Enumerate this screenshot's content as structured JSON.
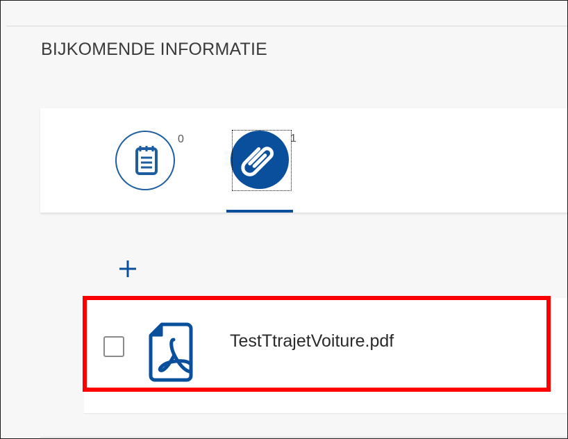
{
  "section": {
    "title": "BIJKOMENDE INFORMATIE"
  },
  "tabs": [
    {
      "icon": "notes-icon",
      "count": "0",
      "selected": false
    },
    {
      "icon": "paperclip-icon",
      "count": "1",
      "selected": true
    }
  ],
  "attachments": {
    "add_icon": "plus-icon",
    "items": [
      {
        "name": "TestTtrajetVoiture.pdf",
        "icon": "pdf-file-icon",
        "checked": false
      }
    ]
  },
  "colors": {
    "accent": "#0a4f9c",
    "highlight": "#ff0000"
  }
}
